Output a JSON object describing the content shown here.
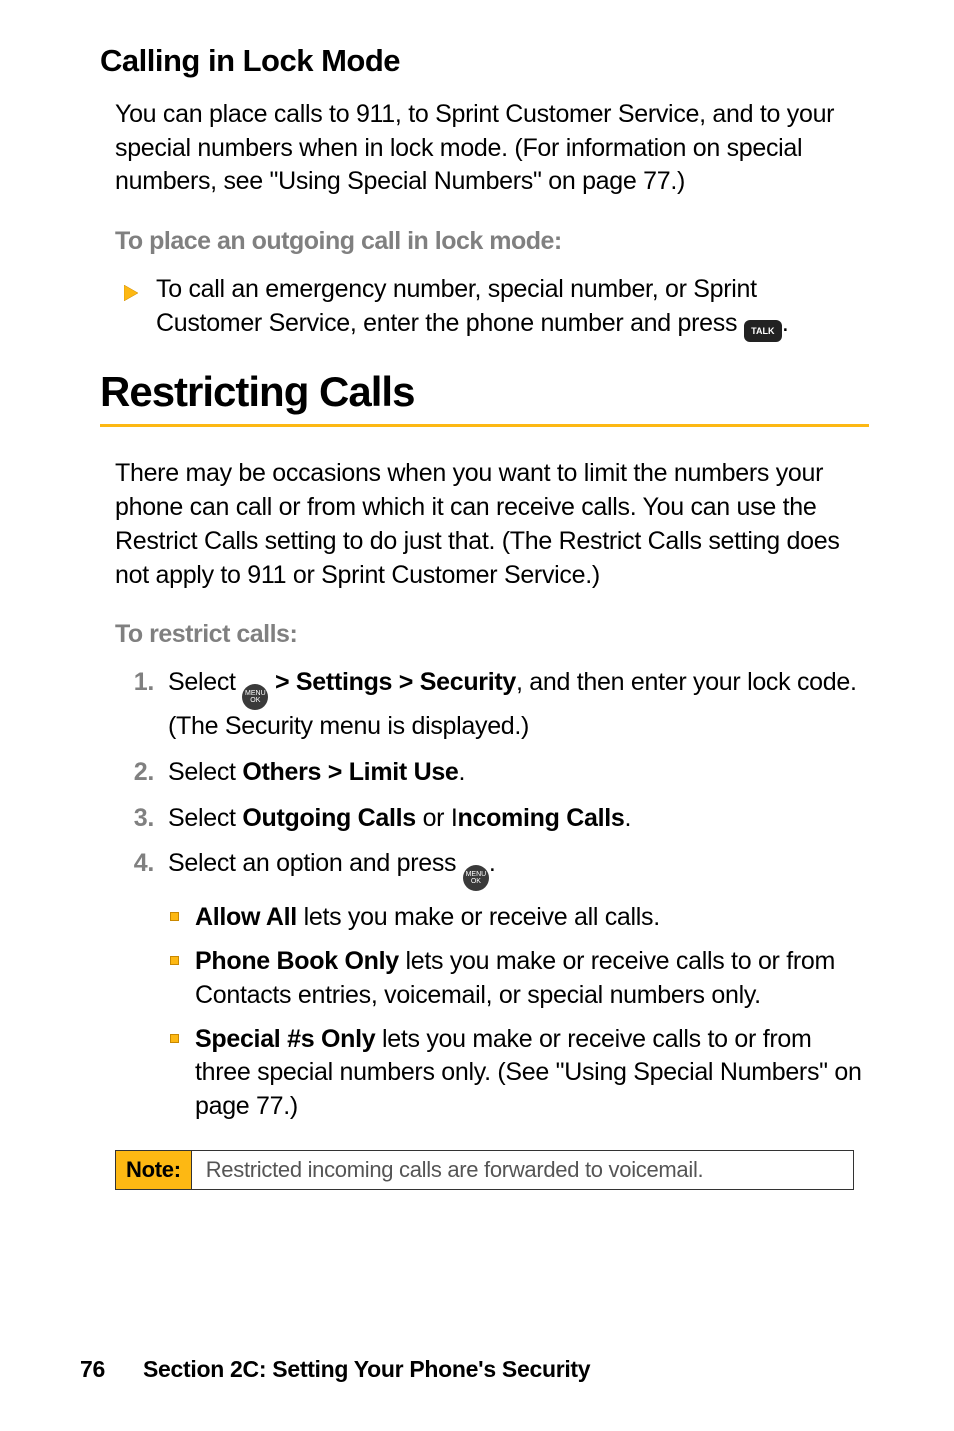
{
  "section1": {
    "heading": "Calling in Lock Mode",
    "para": "You can place calls to 911, to Sprint Customer Service, and to your special numbers when in lock mode. (For information on special numbers, see \"Using Special Numbers\" on page 77.)",
    "subhead": "To place an outgoing call in lock mode:",
    "bullet_pre": "To call an emergency number, special number, or Sprint Customer Service, enter the phone number and press ",
    "bullet_post": "."
  },
  "section2": {
    "h1": "Restricting Calls",
    "para": "There may be occasions when you want to limit the numbers your phone can call or from which it can receive calls. You can use the Restrict Calls setting to do just that. (The Restrict Calls setting does not apply to 911 or Sprint Customer Service.)",
    "subhead": "To restrict calls:",
    "steps": {
      "s1_pre": "Select ",
      "s1_mid_bold": " > Settings > Security",
      "s1_post": ", and then enter your lock code. (The Security menu is displayed.)",
      "s2_pre": "Select ",
      "s2_bold": "Others > Limit Use",
      "s2_post": ".",
      "s3_pre": "Select ",
      "s3_bold1": "Outgoing Calls",
      "s3_mid": " or I",
      "s3_bold2": "ncoming Calls",
      "s3_post": ".",
      "s4_pre": "Select an option and press ",
      "s4_post": "."
    },
    "sub": {
      "a_bold": "Allow All",
      "a_rest": " lets you make or receive all calls.",
      "b_bold": "Phone Book Only",
      "b_rest": " lets you make or receive calls to or from Contacts entries, voicemail, or special numbers only.",
      "c_bold": "Special #s Only",
      "c_rest": " lets you make or receive calls to or from three special numbers only. (See \"Using Special Numbers\" on page 77.)"
    },
    "note_label": "Note:",
    "note_text": "Restricted incoming calls are forwarded to voicemail."
  },
  "footer": {
    "page": "76",
    "section": "Section 2C: Setting Your Phone's Security"
  },
  "icons": {
    "talk": "TALK",
    "menu_ok_top": "MENU",
    "menu_ok_bot": "OK"
  },
  "list_numbers": {
    "n1": "1.",
    "n2": "2.",
    "n3": "3.",
    "n4": "4."
  }
}
